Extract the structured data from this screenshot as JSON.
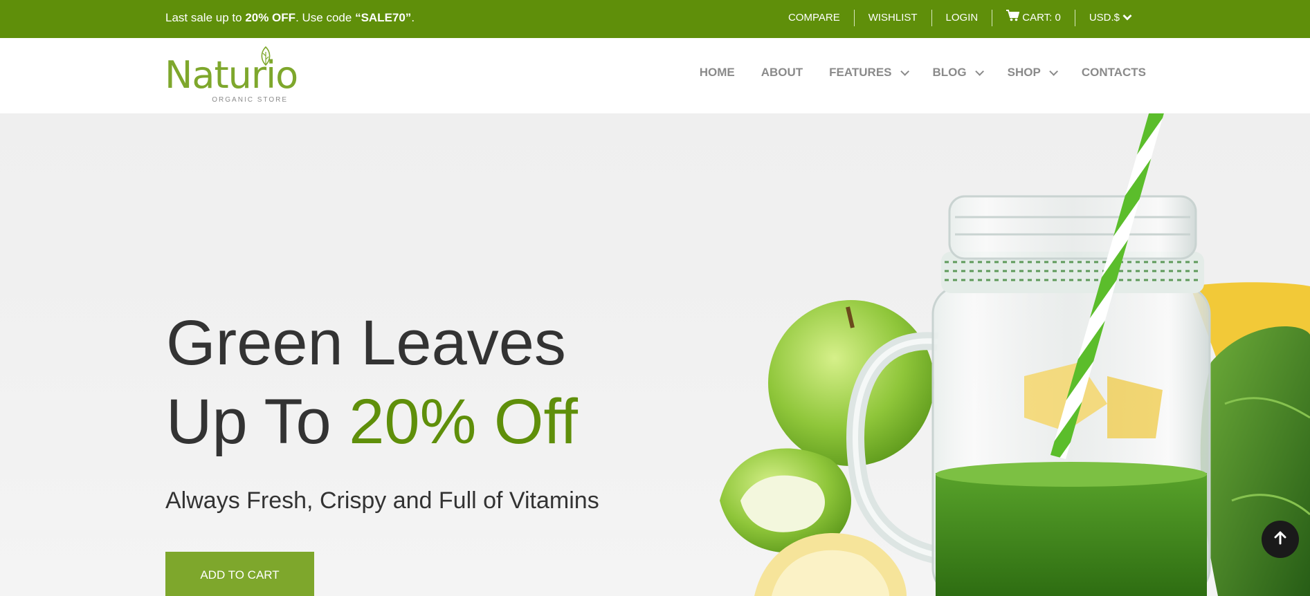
{
  "topbar": {
    "promo_prefix": "Last sale up to ",
    "promo_bold1": "20% OFF",
    "promo_mid": ". Use code ",
    "promo_bold2": "“SALE70”",
    "promo_suffix": ".",
    "links": {
      "compare": "COMPARE",
      "wishlist": "WISHLIST",
      "login": "LOGIN",
      "cart": "CART: 0",
      "currency": "USD.$"
    }
  },
  "header": {
    "logo_word": "Naturio",
    "logo_sub": "ORGANIC STORE",
    "nav": {
      "home": "HOME",
      "about": "ABOUT",
      "features": "FEATURES",
      "blog": "BLOG",
      "shop": "SHOP",
      "contacts": "CONTACTS"
    }
  },
  "hero": {
    "line1": "Green Leaves",
    "line2_prefix": "Up To ",
    "line2_accent": "20% Off",
    "subtitle": "Always Fresh, Crispy and Full of Vitamins",
    "cta_label": "ADD TO CART"
  },
  "colors": {
    "brand_green": "#5f8f0a",
    "button_green": "#7ea72c",
    "nav_gray": "#8a8a8a"
  },
  "icons": {
    "cart": "cart-icon",
    "currency_dropdown": "chevron-down-icon",
    "scroll_top": "arrow-up-icon",
    "logo_leaf": "leaf-icon"
  }
}
